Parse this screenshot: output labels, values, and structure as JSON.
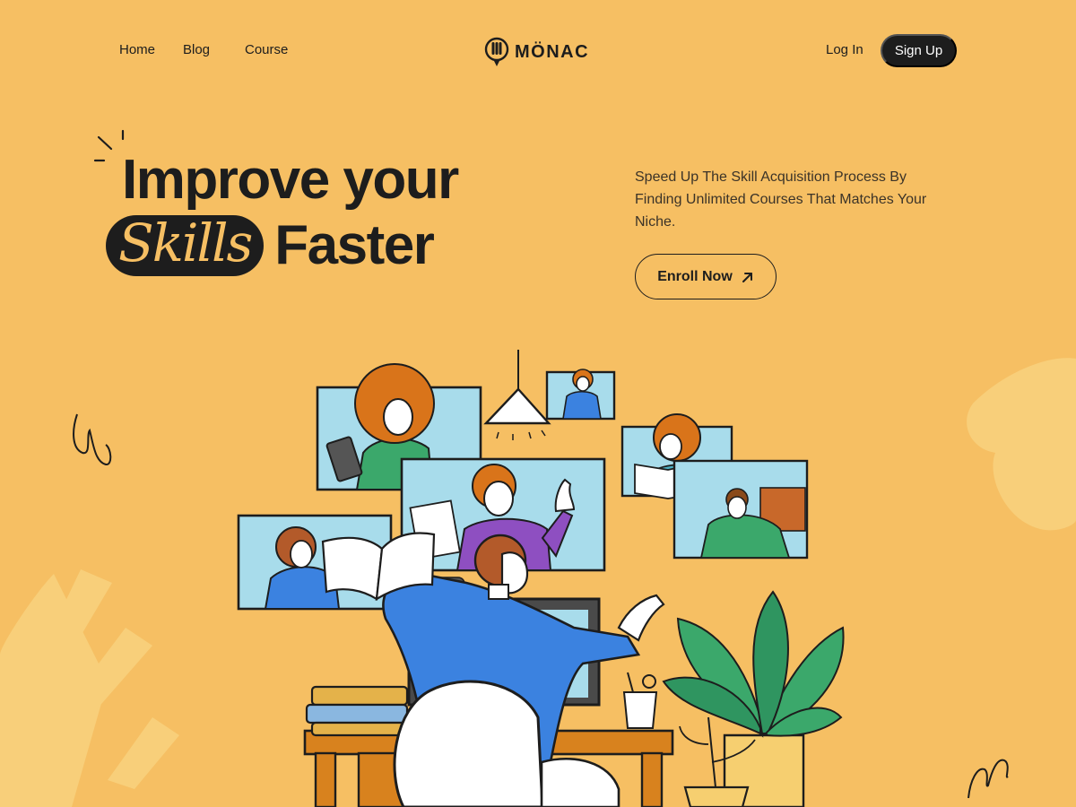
{
  "nav": {
    "links": [
      "Home",
      "Blog",
      "Course"
    ],
    "logo_text": "MÖNAC",
    "login_label": "Log In",
    "signup_label": "Sign Up"
  },
  "hero": {
    "headline_line1": "Improve your",
    "headline_highlight": "Skills",
    "headline_line2_rest": "Faster",
    "subtitle": "Speed Up The Skill Acquisition Process By Finding Unlimited Courses That Matches Your Niche.",
    "cta_label": "Enroll Now",
    "cta_icon": "arrow-up-right-icon"
  },
  "colors": {
    "background": "#F6BF63",
    "dark": "#1D1D1D",
    "screen": "#A8DCEB",
    "blue_shirt": "#3B82E0",
    "leaf": "#3BA86B",
    "desk": "#D8821E",
    "hair": "#D9741A"
  }
}
